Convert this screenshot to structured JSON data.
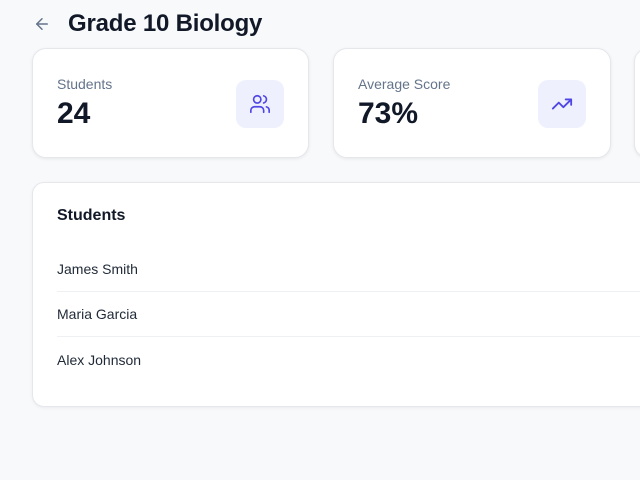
{
  "header": {
    "back_icon": "arrow-left-icon",
    "title": "Grade 10 Biology"
  },
  "stats": [
    {
      "label": "Students",
      "value": "24",
      "icon": "users-icon"
    },
    {
      "label": "Average Score",
      "value": "73%",
      "icon": "trending-up-icon"
    }
  ],
  "students_panel": {
    "title": "Students",
    "rows": [
      {
        "name": "James Smith"
      },
      {
        "name": "Maria Garcia"
      },
      {
        "name": "Alex Johnson"
      }
    ]
  },
  "colors": {
    "accent": "#4f46e5",
    "icon_bg": "#eef0fe",
    "background": "#f8f9fb"
  }
}
